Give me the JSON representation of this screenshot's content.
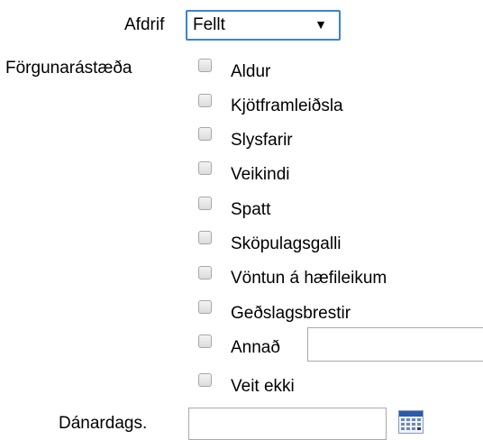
{
  "fields": {
    "afdrif": {
      "label": "Afdrif",
      "selected_value": "Fellt",
      "arrow_glyph": "▼"
    },
    "forgunarastaeda": {
      "label": "Förgunarástæða",
      "options": [
        "Aldur",
        "Kjötframleiðsla",
        "Slysfarir",
        "Veikindi",
        "Spatt",
        "Sköpulagsgalli",
        "Vöntun á hæfileikum",
        "Geðslagsbrestir",
        "Annað",
        "Veit ekki"
      ],
      "other_text_value": ""
    },
    "danardags": {
      "label": "Dánardags.",
      "value": "",
      "calendar_icon": "calendar-icon"
    }
  },
  "colors": {
    "focus_border": "#3c82d6",
    "calendar_blue": "#2a5aa8"
  }
}
